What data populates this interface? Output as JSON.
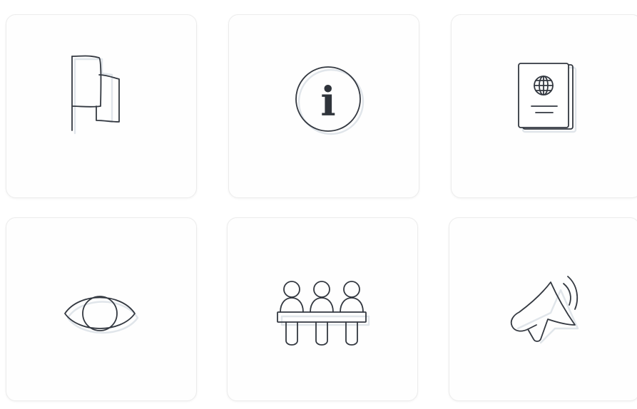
{
  "tiles": [
    {
      "icon": "flag-icon",
      "glyph": ""
    },
    {
      "icon": "info-icon",
      "glyph": "i"
    },
    {
      "icon": "passport-icon",
      "glyph": ""
    },
    {
      "icon": "eye-icon",
      "glyph": ""
    },
    {
      "icon": "audience-icon",
      "glyph": ""
    },
    {
      "icon": "megaphone-icon",
      "glyph": ""
    }
  ],
  "colors": {
    "icon_stroke": "#333840",
    "icon_shadow": "#c7cfd9",
    "tile_border": "#ececec",
    "background": "#ffffff"
  }
}
